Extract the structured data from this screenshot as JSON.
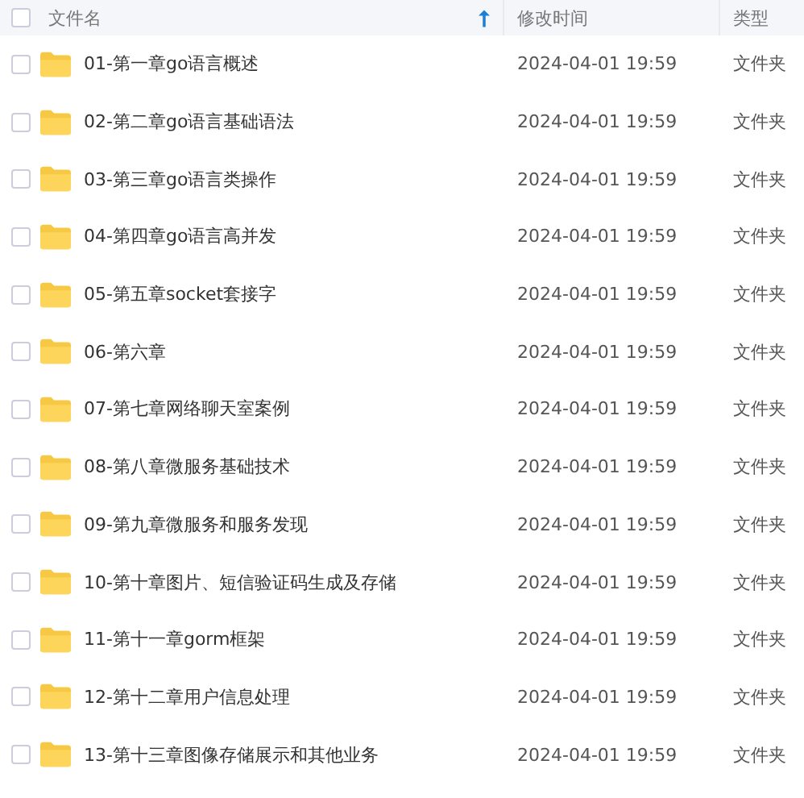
{
  "table": {
    "columns": [
      {
        "label": "文件名",
        "sorted": true
      },
      {
        "label": "修改时间",
        "sorted": false
      },
      {
        "label": "类型",
        "sorted": false
      }
    ],
    "header_checked": false,
    "rows": [
      {
        "name": "01-第一章go语言概述",
        "modified": "2024-04-01 19:59",
        "type": "文件夹",
        "checked": false
      },
      {
        "name": "02-第二章go语言基础语法",
        "modified": "2024-04-01 19:59",
        "type": "文件夹",
        "checked": false
      },
      {
        "name": "03-第三章go语言类操作",
        "modified": "2024-04-01 19:59",
        "type": "文件夹",
        "checked": false
      },
      {
        "name": "04-第四章go语言高并发",
        "modified": "2024-04-01 19:59",
        "type": "文件夹",
        "checked": false
      },
      {
        "name": "05-第五章socket套接字",
        "modified": "2024-04-01 19:59",
        "type": "文件夹",
        "checked": false
      },
      {
        "name": "06-第六章",
        "modified": "2024-04-01 19:59",
        "type": "文件夹",
        "checked": false
      },
      {
        "name": "07-第七章网络聊天室案例",
        "modified": "2024-04-01 19:59",
        "type": "文件夹",
        "checked": false
      },
      {
        "name": "08-第八章微服务基础技术",
        "modified": "2024-04-01 19:59",
        "type": "文件夹",
        "checked": false
      },
      {
        "name": "09-第九章微服务和服务发现",
        "modified": "2024-04-01 19:59",
        "type": "文件夹",
        "checked": false
      },
      {
        "name": "10-第十章图片、短信验证码生成及存储",
        "modified": "2024-04-01 19:59",
        "type": "文件夹",
        "checked": false
      },
      {
        "name": "11-第十一章gorm框架",
        "modified": "2024-04-01 19:59",
        "type": "文件夹",
        "checked": false
      },
      {
        "name": "12-第十二章用户信息处理",
        "modified": "2024-04-01 19:59",
        "type": "文件夹",
        "checked": false
      },
      {
        "name": "13-第十三章图像存储展示和其他业务",
        "modified": "2024-04-01 19:59",
        "type": "文件夹",
        "checked": false
      }
    ]
  }
}
